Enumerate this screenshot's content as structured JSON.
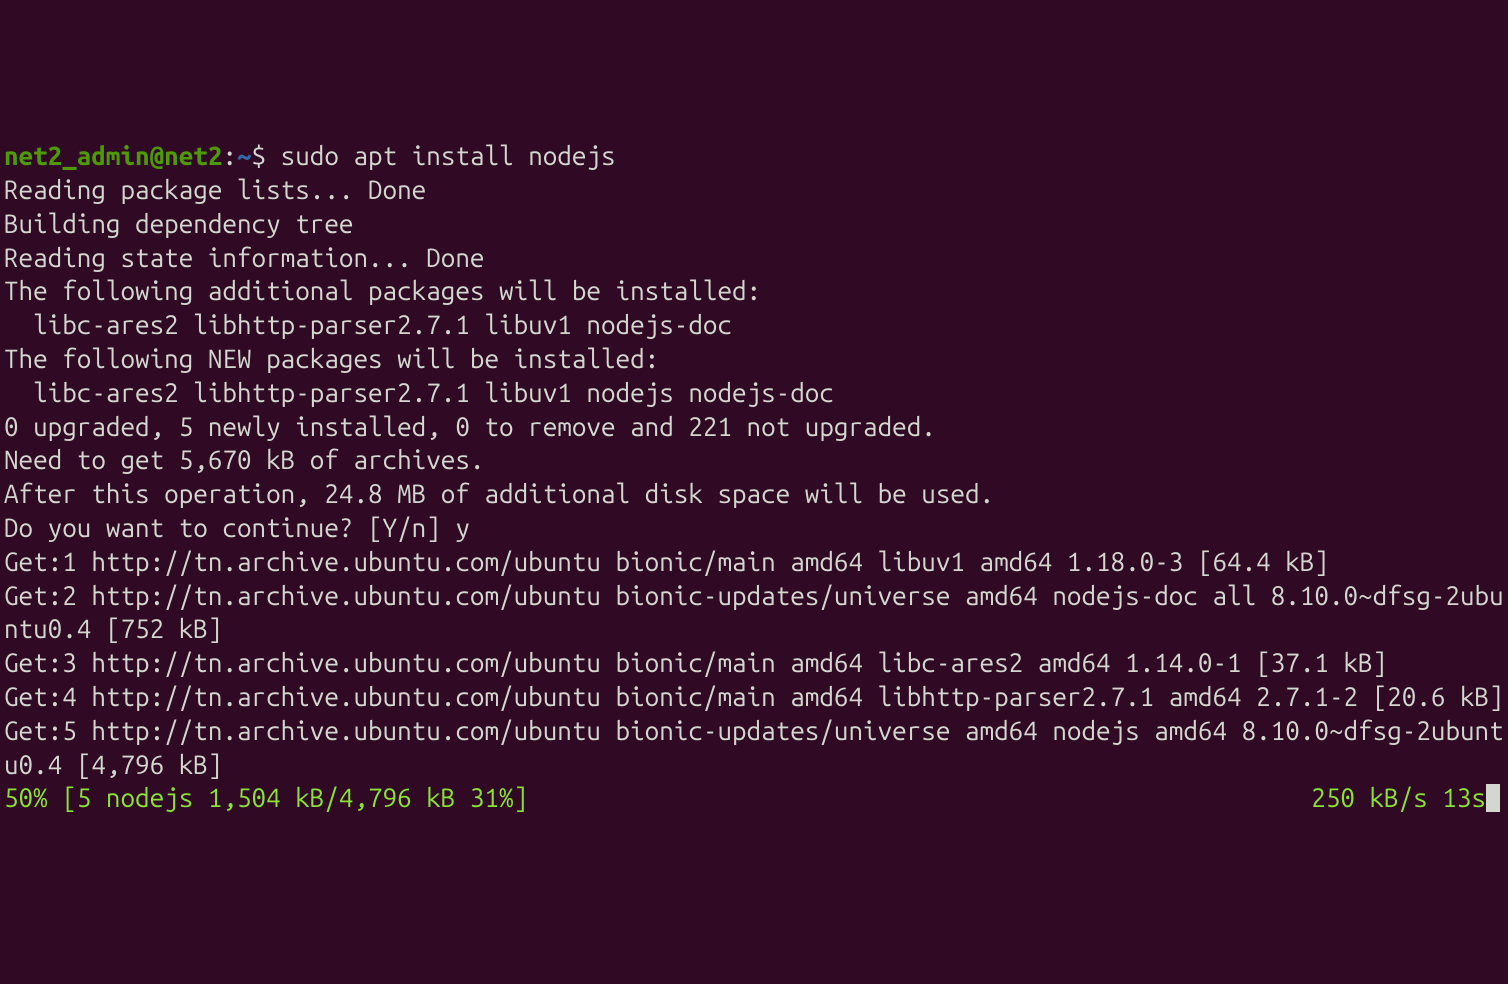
{
  "prompt": {
    "user": "net2_admin",
    "at": "@",
    "host": "net2",
    "colon": ":",
    "path": "~",
    "symbol": "$ "
  },
  "command": "sudo apt install nodejs",
  "output": {
    "line1": "Reading package lists... Done",
    "line2": "Building dependency tree",
    "line3": "Reading state information... Done",
    "line4": "The following additional packages will be installed:",
    "line5": "  libc-ares2 libhttp-parser2.7.1 libuv1 nodejs-doc",
    "line6": "The following NEW packages will be installed:",
    "line7": "  libc-ares2 libhttp-parser2.7.1 libuv1 nodejs nodejs-doc",
    "line8": "0 upgraded, 5 newly installed, 0 to remove and 221 not upgraded.",
    "line9": "Need to get 5,670 kB of archives.",
    "line10": "After this operation, 24.8 MB of additional disk space will be used.",
    "line11": "Do you want to continue? [Y/n] y",
    "line12": "Get:1 http://tn.archive.ubuntu.com/ubuntu bionic/main amd64 libuv1 amd64 1.18.0-3 [64.4 kB]",
    "line13": "Get:2 http://tn.archive.ubuntu.com/ubuntu bionic-updates/universe amd64 nodejs-doc all 8.10.0~dfsg-2ubuntu0.4 [752 kB]",
    "line14": "Get:3 http://tn.archive.ubuntu.com/ubuntu bionic/main amd64 libc-ares2 amd64 1.14.0-1 [37.1 kB]",
    "line15": "Get:4 http://tn.archive.ubuntu.com/ubuntu bionic/main amd64 libhttp-parser2.7.1 amd64 2.7.1-2 [20.6 kB]",
    "line16": "Get:5 http://tn.archive.ubuntu.com/ubuntu bionic-updates/universe amd64 nodejs amd64 8.10.0~dfsg-2ubuntu0.4 [4,796 kB]"
  },
  "progress": {
    "left": "50% [5 nodejs 1,504 kB/4,796 kB 31%]",
    "right": "250 kB/s 13s"
  }
}
